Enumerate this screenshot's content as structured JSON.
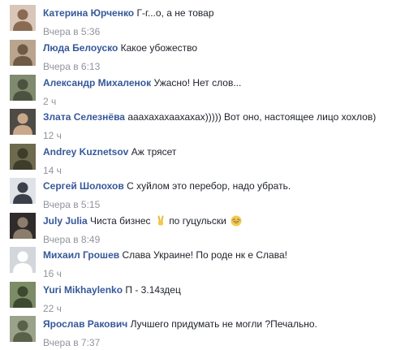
{
  "comments": [
    {
      "author": "Катерина Юрченко",
      "text": "Г-г...о, а не товар",
      "time": "Вчера в 5:36",
      "avatar": {
        "bg": "#d8c7b8",
        "fg": "#8a6a52"
      }
    },
    {
      "author": "Люда Белоуско",
      "text": "Какое убожество",
      "time": "Вчера в 6:13",
      "avatar": {
        "bg": "#b9a58e",
        "fg": "#6e5a45"
      }
    },
    {
      "author": "Александр Михаленок",
      "text": "Ужасно! Нет слов...",
      "time": "2 ч",
      "avatar": {
        "bg": "#7f8a6e",
        "fg": "#4b5240"
      }
    },
    {
      "author": "Злата Селезнёва",
      "text": "ааахахахаахахах))))) Вот оно, настоящее лицо хохлов)",
      "time": "12 ч",
      "avatar": {
        "bg": "#4e4a45",
        "fg": "#c9a88a"
      }
    },
    {
      "author": "Andrey Kuznetsov",
      "text": "Аж трясет",
      "time": "14 ч",
      "avatar": {
        "bg": "#6d6a4e",
        "fg": "#3e3c2b"
      }
    },
    {
      "author": "Сергей Шолохов",
      "text": "С хуйлом это перебор, надо убрать.",
      "time": "Вчера в 5:15",
      "avatar": {
        "bg": "#dfe3e8",
        "fg": "#3a3f4a"
      }
    },
    {
      "author": "July Julia",
      "text": "Чиста бизнес",
      "text2": "по гуцульски",
      "time": "Вчера в 8:49",
      "avatar": {
        "bg": "#2f2b2a",
        "fg": "#8b7d6b"
      }
    },
    {
      "author": "Михаил Грошев",
      "text": "Слава Украине! По роде нк е Слава!",
      "time": "16 ч",
      "avatar": {
        "bg": "#d3d6db",
        "fg": "#ffffff"
      }
    },
    {
      "author": "Yuri Mikhaylenko",
      "text": "П - 3.14здец",
      "time": "22 ч",
      "avatar": {
        "bg": "#7c8c66",
        "fg": "#3d4a2f"
      }
    },
    {
      "author": "Ярослав Ракович",
      "text": "Лучшего придумать не могли ?Печально.",
      "time": "Вчера в 7:37",
      "avatar": {
        "bg": "#9aa28a",
        "fg": "#5a6149"
      }
    }
  ],
  "colors": {
    "author": "#365899",
    "text": "#1d2129",
    "time": "#90949c"
  },
  "icons": {
    "victory": "victory-hand-icon",
    "laugh": "laughing-emoji-icon"
  }
}
